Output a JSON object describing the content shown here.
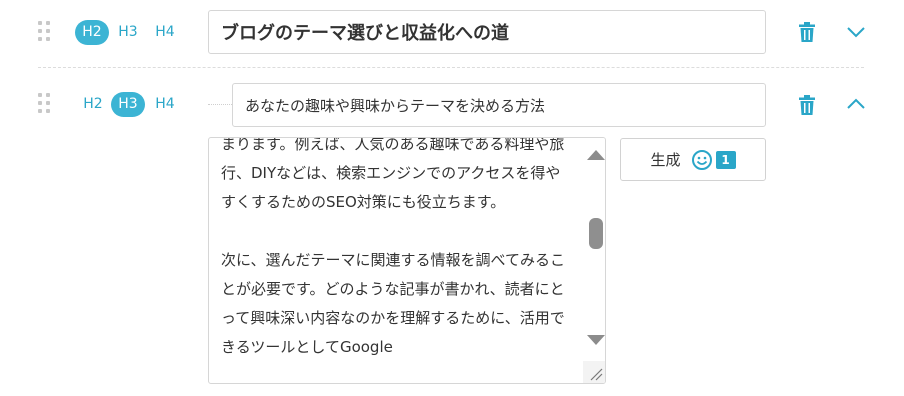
{
  "section1": {
    "levels": [
      "H2",
      "H3",
      "H4"
    ],
    "active_level": "H2",
    "title": "ブログのテーマ選びと収益化への道"
  },
  "section2": {
    "levels": [
      "H2",
      "H3",
      "H4"
    ],
    "active_level": "H3",
    "title": "あなたの趣味や興味からテーマを決める方法",
    "content": "まります。例えば、人気のある趣味である料理や旅行、DIYなどは、検索エンジンでのアクセスを得やすくするためのSEO対策にも役立ちます。\n\n次に、選んだテーマに関連する情報を調べてみることが必要です。どのような記事が書かれ、読者にとって興味深い内容なのかを理解するために、活用できるツールとしてGoogle",
    "generate_label": "生成",
    "generate_count": "1"
  },
  "colors": {
    "accent": "#3cb4d4",
    "icon": "#2aa6c8",
    "scrollbar": "#8c8c8c"
  },
  "icons": {
    "drag": "drag-handle-icon",
    "trash": "trash-icon",
    "chevron_down": "chevron-down-icon",
    "chevron_up": "chevron-up-icon",
    "smile": "smile-face-icon"
  }
}
